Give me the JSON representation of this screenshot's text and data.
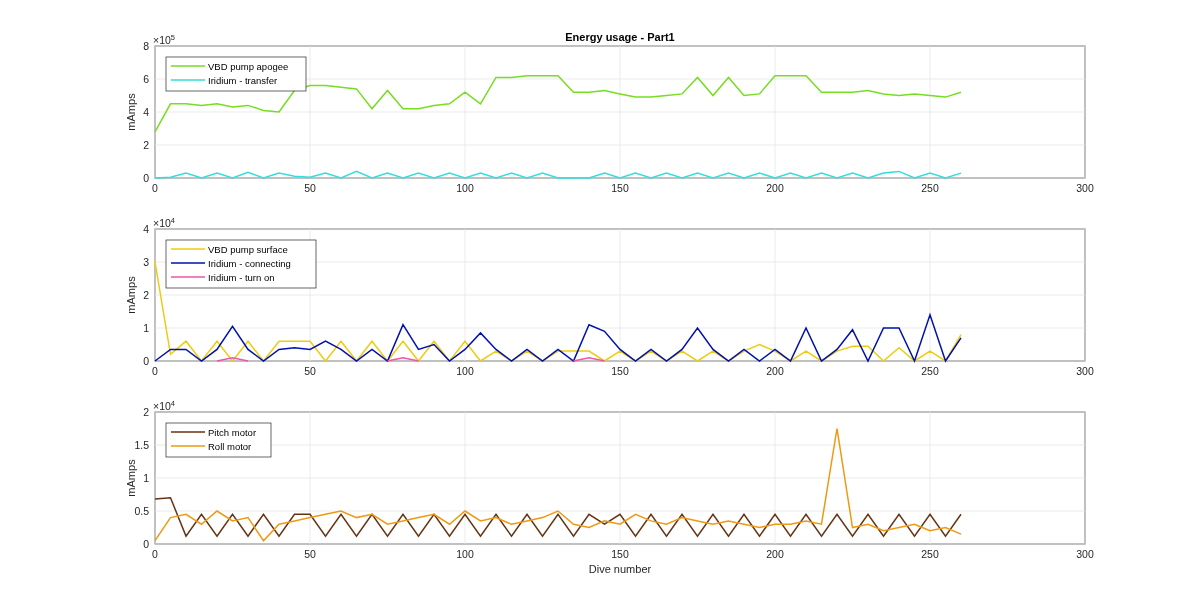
{
  "charts": [
    {
      "exponent": "×10$^{5}$",
      "chart_data": {
        "type": "line",
        "grid": true,
        "legend": true,
        "title": "Energy usage - Part1",
        "ylabel": "mAmps",
        "xlim": [
          0,
          300
        ],
        "ylim": [
          0,
          8
        ],
        "xticks": [
          0,
          50,
          100,
          150,
          200,
          250,
          300
        ],
        "yticks": [
          0,
          2,
          4,
          6,
          8
        ],
        "x": [
          0,
          5,
          10,
          15,
          20,
          25,
          30,
          35,
          40,
          45,
          50,
          55,
          60,
          65,
          70,
          75,
          80,
          85,
          90,
          95,
          100,
          105,
          110,
          115,
          120,
          125,
          130,
          135,
          140,
          145,
          150,
          155,
          160,
          165,
          170,
          175,
          180,
          185,
          190,
          195,
          200,
          205,
          210,
          215,
          220,
          225,
          230,
          235,
          240,
          245,
          250,
          255,
          260
        ],
        "series": [
          {
            "name": "VBD pump apogee",
            "color": "#77dd22",
            "values": [
              2.8,
              4.5,
              4.5,
              4.4,
              4.5,
              4.3,
              4.4,
              4.1,
              4.0,
              5.3,
              5.6,
              5.6,
              5.5,
              5.4,
              4.2,
              5.3,
              4.2,
              4.2,
              4.4,
              4.5,
              5.2,
              4.5,
              6.1,
              6.1,
              6.2,
              6.2,
              6.2,
              5.2,
              5.2,
              5.3,
              5.1,
              4.9,
              4.9,
              5.0,
              5.1,
              6.1,
              5.0,
              6.1,
              5.0,
              5.1,
              6.2,
              6.2,
              6.2,
              5.2,
              5.2,
              5.2,
              5.3,
              5.1,
              5.0,
              5.1,
              5.0,
              4.9,
              5.2
            ]
          },
          {
            "name": "Iridium - transfer",
            "color": "#33dddd",
            "values": [
              0,
              0.05,
              0.3,
              0,
              0.3,
              0,
              0.35,
              0,
              0.3,
              0.1,
              0.05,
              0.3,
              0,
              0.4,
              0,
              0.3,
              0,
              0.3,
              0,
              0.3,
              0,
              0.3,
              0,
              0.3,
              0,
              0.3,
              0,
              0,
              0,
              0.3,
              0,
              0.3,
              0,
              0.3,
              0,
              0.3,
              0,
              0.3,
              0,
              0.3,
              0,
              0.3,
              0,
              0.3,
              0,
              0.3,
              0,
              0.3,
              0.4,
              0,
              0.3,
              0,
              0.3
            ]
          }
        ]
      }
    },
    {
      "exponent": "×10$^{4}$",
      "chart_data": {
        "type": "line",
        "grid": true,
        "legend": true,
        "ylabel": "mAmps",
        "xlim": [
          0,
          300
        ],
        "ylim": [
          0,
          4
        ],
        "xticks": [
          0,
          50,
          100,
          150,
          200,
          250,
          300
        ],
        "yticks": [
          0,
          1,
          2,
          3,
          4
        ],
        "x": [
          0,
          5,
          10,
          15,
          20,
          25,
          30,
          35,
          40,
          45,
          50,
          55,
          60,
          65,
          70,
          75,
          80,
          85,
          90,
          95,
          100,
          105,
          110,
          115,
          120,
          125,
          130,
          135,
          140,
          145,
          150,
          155,
          160,
          165,
          170,
          175,
          180,
          185,
          190,
          195,
          200,
          205,
          210,
          215,
          220,
          225,
          230,
          235,
          240,
          245,
          250,
          255,
          260
        ],
        "series": [
          {
            "name": "VBD pump surface",
            "color": "#eecc11",
            "values": [
              3.0,
              0.2,
              0.6,
              0,
              0.6,
              0,
              0.6,
              0,
              0.6,
              0.6,
              0.6,
              0,
              0.6,
              0,
              0.6,
              0,
              0.6,
              0,
              0.6,
              0,
              0.6,
              0,
              0.3,
              0,
              0.3,
              0,
              0.3,
              0.3,
              0.3,
              0,
              0.3,
              0,
              0.3,
              0,
              0.3,
              0,
              0.3,
              0,
              0.3,
              0.5,
              0.3,
              0,
              0.3,
              0,
              0.3,
              0.45,
              0.45,
              0,
              0.4,
              0,
              0.3,
              0,
              0.8
            ]
          },
          {
            "name": "Iridium - connecting",
            "color": "#0011aa",
            "values": [
              0,
              0.35,
              0.35,
              0,
              0.35,
              1.05,
              0.35,
              0,
              0.35,
              0.4,
              0.35,
              0.6,
              0.35,
              0,
              0.35,
              0,
              1.1,
              0.35,
              0.5,
              0,
              0.35,
              0.85,
              0.35,
              0,
              0.35,
              0,
              0.35,
              0,
              1.1,
              0.9,
              0.35,
              0,
              0.35,
              0,
              0.35,
              1.0,
              0.35,
              0,
              0.35,
              0,
              0.35,
              0,
              1.0,
              0,
              0.35,
              0.95,
              0,
              1.0,
              1.0,
              0,
              1.4,
              0,
              0.7
            ]
          },
          {
            "name": "Iridium - turn on",
            "color": "#ee55aa",
            "values": [
              null,
              null,
              null,
              null,
              0,
              0.1,
              0,
              null,
              null,
              null,
              null,
              null,
              null,
              null,
              null,
              0,
              0.1,
              0,
              null,
              null,
              null,
              null,
              null,
              null,
              null,
              null,
              null,
              0,
              0.1,
              0,
              null,
              null,
              null,
              null,
              null,
              null,
              null,
              null,
              null,
              null,
              null,
              null,
              null,
              null,
              null,
              null,
              null,
              null,
              null,
              null,
              null,
              null,
              null
            ]
          }
        ]
      }
    },
    {
      "exponent": "×10$^{4}$",
      "chart_data": {
        "type": "line",
        "grid": true,
        "legend": true,
        "xlabel": "Dive number",
        "ylabel": "mAmps",
        "xlim": [
          0,
          300
        ],
        "ylim": [
          0,
          2
        ],
        "xticks": [
          0,
          50,
          100,
          150,
          200,
          250,
          300
        ],
        "yticks": [
          0,
          0.5,
          1,
          1.5,
          2
        ],
        "x": [
          0,
          5,
          10,
          15,
          20,
          25,
          30,
          35,
          40,
          45,
          50,
          55,
          60,
          65,
          70,
          75,
          80,
          85,
          90,
          95,
          100,
          105,
          110,
          115,
          120,
          125,
          130,
          135,
          140,
          145,
          150,
          155,
          160,
          165,
          170,
          175,
          180,
          185,
          190,
          195,
          200,
          205,
          210,
          215,
          220,
          225,
          230,
          235,
          240,
          245,
          250,
          255,
          260
        ],
        "series": [
          {
            "name": "Pitch motor",
            "color": "#663311",
            "values": [
              0.68,
              0.7,
              0.12,
              0.45,
              0.12,
              0.45,
              0.12,
              0.45,
              0.12,
              0.45,
              0.45,
              0.12,
              0.45,
              0.12,
              0.45,
              0.12,
              0.45,
              0.12,
              0.45,
              0.12,
              0.45,
              0.12,
              0.45,
              0.12,
              0.45,
              0.12,
              0.45,
              0.12,
              0.45,
              0.3,
              0.45,
              0.12,
              0.45,
              0.12,
              0.45,
              0.12,
              0.45,
              0.12,
              0.45,
              0.12,
              0.45,
              0.12,
              0.45,
              0.12,
              0.45,
              0.12,
              0.45,
              0.12,
              0.45,
              0.12,
              0.45,
              0.12,
              0.45
            ]
          },
          {
            "name": "Roll motor",
            "color": "#ee9911",
            "values": [
              0.05,
              0.4,
              0.45,
              0.3,
              0.5,
              0.35,
              0.4,
              0.05,
              0.3,
              0.35,
              0.4,
              0.45,
              0.5,
              0.4,
              0.45,
              0.3,
              0.35,
              0.4,
              0.45,
              0.3,
              0.5,
              0.35,
              0.4,
              0.3,
              0.35,
              0.4,
              0.5,
              0.3,
              0.25,
              0.35,
              0.3,
              0.45,
              0.35,
              0.3,
              0.4,
              0.35,
              0.3,
              0.35,
              0.3,
              0.25,
              0.3,
              0.3,
              0.35,
              0.3,
              1.75,
              0.25,
              0.3,
              0.2,
              0.25,
              0.3,
              0.2,
              0.25,
              0.15
            ]
          }
        ]
      }
    }
  ]
}
